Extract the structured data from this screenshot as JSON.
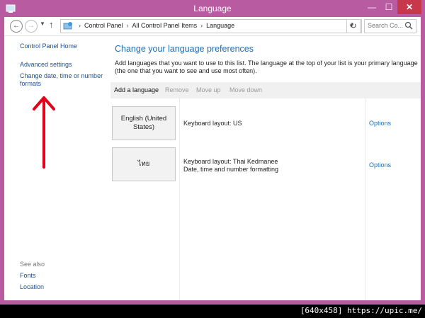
{
  "window": {
    "title": "Language",
    "controls": {
      "minimize": "—",
      "maximize": "☐",
      "close": "✕"
    }
  },
  "address_bar": {
    "breadcrumbs": [
      "Control Panel",
      "All Control Panel Items",
      "Language"
    ],
    "search_placeholder": "Search Co..."
  },
  "sidebar": {
    "home": "Control Panel Home",
    "advanced": "Advanced settings",
    "formats": "Change date, time or number formats",
    "see_also_label": "See also",
    "see_also": [
      "Fonts",
      "Location"
    ]
  },
  "main": {
    "heading": "Change your language preferences",
    "description": "Add languages that you want to use to this list. The language at the top of your list is your primary language (the one that you want to see and use most often).",
    "toolbar": {
      "add": "Add a language",
      "remove": "Remove",
      "move_up": "Move up",
      "move_down": "Move down"
    },
    "languages": [
      {
        "name": "English (United States)",
        "details": [
          "Keyboard layout: US"
        ],
        "options": "Options"
      },
      {
        "name": "ไทย",
        "details": [
          "Keyboard layout: Thai Kedmanee",
          "Date, time and number formatting"
        ],
        "options": "Options"
      }
    ]
  },
  "annotation": {
    "arrow_color": "#e2001a"
  },
  "watermark": "[640x458] https://upic.me/",
  "colors": {
    "frame": "#b85ba0",
    "link": "#1e4e9a",
    "heading": "#1e6fb8",
    "close_button": "#c7394a"
  }
}
